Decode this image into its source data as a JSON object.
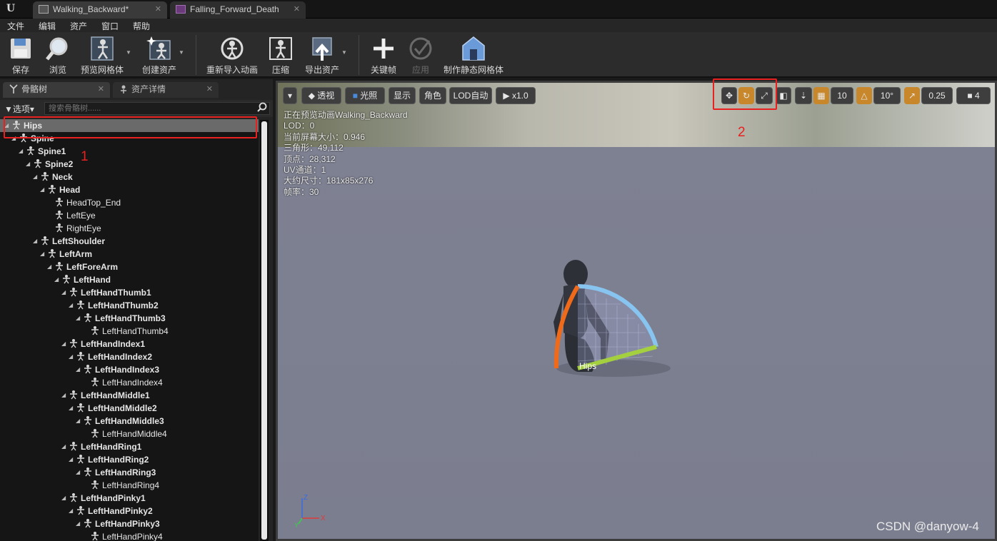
{
  "tabs": [
    {
      "label": "Walking_Backward*"
    },
    {
      "label": "Falling_Forward_Death"
    }
  ],
  "menu": [
    "文件",
    "编辑",
    "资产",
    "窗口",
    "帮助"
  ],
  "toolbar": {
    "save": "保存",
    "browse": "浏览",
    "preview_mesh": "预览网格体",
    "create_asset": "创建资产",
    "reimport": "重新导入动画",
    "compress": "压缩",
    "export": "导出资产",
    "keyframe": "关键帧",
    "apply": "应用",
    "make_static_mesh": "制作静态网格体"
  },
  "left_panel": {
    "tab_skeleton": "骨骼树",
    "tab_asset_details": "资产详情",
    "options": "选项",
    "search_placeholder": "搜索骨骼树......"
  },
  "bones": [
    {
      "name": "Hips",
      "depth": 0,
      "bold": true,
      "expanded": true,
      "selected": true
    },
    {
      "name": "Spine",
      "depth": 1,
      "bold": true,
      "expanded": true
    },
    {
      "name": "Spine1",
      "depth": 2,
      "bold": true,
      "expanded": true
    },
    {
      "name": "Spine2",
      "depth": 3,
      "bold": true,
      "expanded": true
    },
    {
      "name": "Neck",
      "depth": 4,
      "bold": true,
      "expanded": true
    },
    {
      "name": "Head",
      "depth": 5,
      "bold": true,
      "expanded": true
    },
    {
      "name": "HeadTop_End",
      "depth": 6,
      "bold": false,
      "expanded": false
    },
    {
      "name": "LeftEye",
      "depth": 6,
      "bold": false,
      "expanded": false
    },
    {
      "name": "RightEye",
      "depth": 6,
      "bold": false,
      "expanded": false
    },
    {
      "name": "LeftShoulder",
      "depth": 4,
      "bold": true,
      "expanded": true
    },
    {
      "name": "LeftArm",
      "depth": 5,
      "bold": true,
      "expanded": true
    },
    {
      "name": "LeftForeArm",
      "depth": 6,
      "bold": true,
      "expanded": true
    },
    {
      "name": "LeftHand",
      "depth": 7,
      "bold": true,
      "expanded": true
    },
    {
      "name": "LeftHandThumb1",
      "depth": 8,
      "bold": true,
      "expanded": true
    },
    {
      "name": "LeftHandThumb2",
      "depth": 9,
      "bold": true,
      "expanded": true
    },
    {
      "name": "LeftHandThumb3",
      "depth": 10,
      "bold": true,
      "expanded": true
    },
    {
      "name": "LeftHandThumb4",
      "depth": 11,
      "bold": false,
      "expanded": false
    },
    {
      "name": "LeftHandIndex1",
      "depth": 8,
      "bold": true,
      "expanded": true
    },
    {
      "name": "LeftHandIndex2",
      "depth": 9,
      "bold": true,
      "expanded": true
    },
    {
      "name": "LeftHandIndex3",
      "depth": 10,
      "bold": true,
      "expanded": true
    },
    {
      "name": "LeftHandIndex4",
      "depth": 11,
      "bold": false,
      "expanded": false
    },
    {
      "name": "LeftHandMiddle1",
      "depth": 8,
      "bold": true,
      "expanded": true
    },
    {
      "name": "LeftHandMiddle2",
      "depth": 9,
      "bold": true,
      "expanded": true
    },
    {
      "name": "LeftHandMiddle3",
      "depth": 10,
      "bold": true,
      "expanded": true
    },
    {
      "name": "LeftHandMiddle4",
      "depth": 11,
      "bold": false,
      "expanded": false
    },
    {
      "name": "LeftHandRing1",
      "depth": 8,
      "bold": true,
      "expanded": true
    },
    {
      "name": "LeftHandRing2",
      "depth": 9,
      "bold": true,
      "expanded": true
    },
    {
      "name": "LeftHandRing3",
      "depth": 10,
      "bold": true,
      "expanded": true
    },
    {
      "name": "LeftHandRing4",
      "depth": 11,
      "bold": false,
      "expanded": false
    },
    {
      "name": "LeftHandPinky1",
      "depth": 8,
      "bold": true,
      "expanded": true
    },
    {
      "name": "LeftHandPinky2",
      "depth": 9,
      "bold": true,
      "expanded": true
    },
    {
      "name": "LeftHandPinky3",
      "depth": 10,
      "bold": true,
      "expanded": true
    },
    {
      "name": "LeftHandPinky4",
      "depth": 11,
      "bold": false,
      "expanded": false
    }
  ],
  "viewport": {
    "perspective": "透视",
    "lit": "光照",
    "show": "显示",
    "character": "角色",
    "lod_auto": "LOD自动",
    "speed": "x1.0",
    "grid_snap": "10",
    "rot_snap": "10°",
    "scale_snap": "0.25",
    "camera_speed": "4",
    "info": [
      "正在预览动画Walking_Backward",
      "LOD：0",
      "当前屏幕大小：0.946",
      "三角形：49,112",
      "顶点：28,312",
      "UV通道：1",
      "大约尺寸：181x85x276",
      "帧率：30"
    ],
    "gizmo_label": "Hips",
    "axis_z": "Z",
    "axis_x": "X",
    "axis_y": "Y"
  },
  "annotations": {
    "one": "1",
    "two": "2"
  },
  "watermark": "CSDN @danyow-4",
  "colors": {
    "selection": "#6a6a6a",
    "accent_gold": "#c7872a",
    "annotation_red": "#e82020"
  }
}
